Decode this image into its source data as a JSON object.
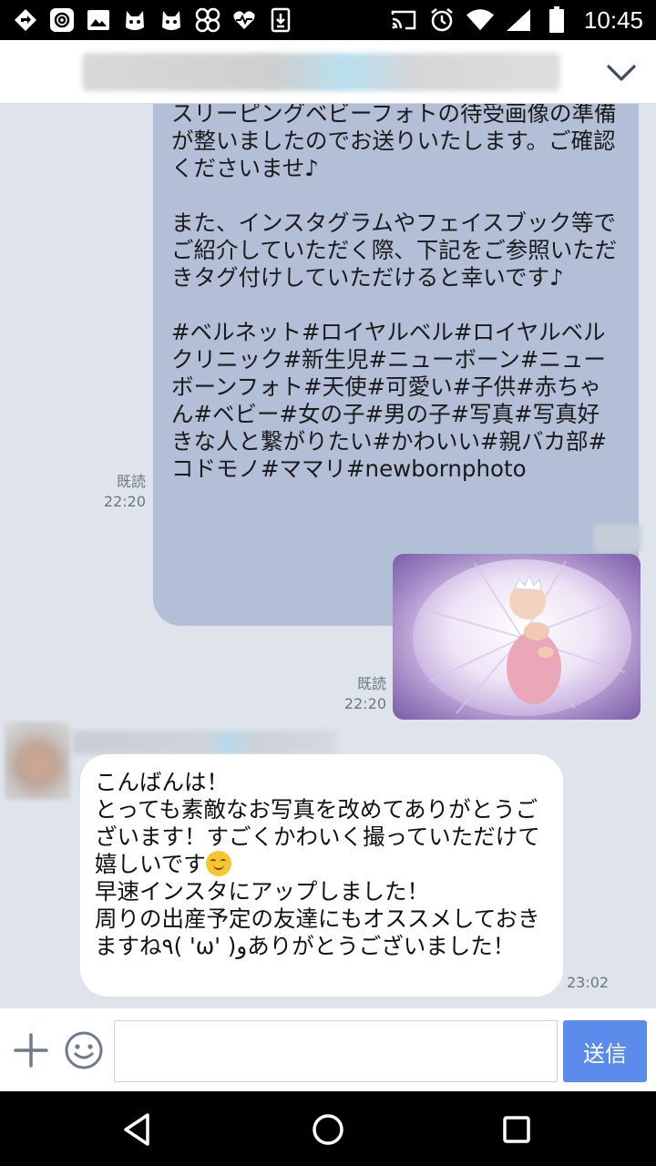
{
  "status_bar": {
    "time": "10:45",
    "left_icons": [
      "navigation-icon",
      "at-sign-icon",
      "photo-icon",
      "cat-icon",
      "cat-icon",
      "flower-icon",
      "heart-rate-icon",
      "download-icon"
    ],
    "right_icons": [
      "cast-icon",
      "alarm-icon",
      "wifi-icon",
      "signal-icon",
      "battery-icon"
    ]
  },
  "header": {
    "chat_title": "",
    "menu_icon": "chevron-down-icon"
  },
  "messages": {
    "outgoing_text": {
      "paragraphs": [
        "スリーピングベビーフォトの待受画像の準備が整いましたのでお送りいたします。ご確認くださいませ♪",
        "また、インスタグラムやフェイスブック等でご紹介していただく際、下記をご参照いただきタグ付けしていただけると幸いです♪",
        "#ベルネット#ロイヤルベル#ロイヤルベルクリニック#新生児#ニューボーン#ニューボーンフォト#天使#可愛い#子供#赤ちゃん#ベビー#女の子#男の子#写真#写真好きな人と繋がりたい#かわいい#親バカ部#コドモノ#ママリ#newbornphoto"
      ],
      "read_label": "既読",
      "time": "22:20"
    },
    "outgoing_photo": {
      "read_label": "既読",
      "time": "22:20"
    },
    "incoming": {
      "text_before_emoji": "こんばんは！\nとっても素敵なお写真を改めてありがとうございます！すごくかわいく撮っていただけて嬉しいです",
      "text_after_emoji": "\n早速インスタにアップしました！\n周りの出産予定の友達にもオススメしておきますね٩( 'ω' )وありがとうございました！",
      "time": "23:02"
    }
  },
  "input_bar": {
    "placeholder": "",
    "send_label": "送信"
  },
  "colors": {
    "chat_bg": "#dfe4ec",
    "outgoing_bubble": "#b3bfd6",
    "send_button": "#5b8cec"
  }
}
